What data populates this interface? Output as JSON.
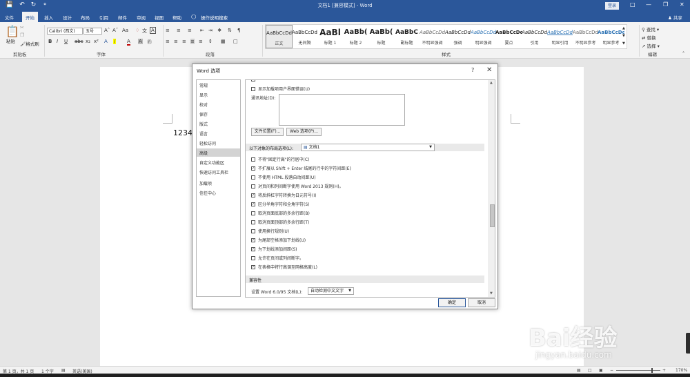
{
  "title": "文档1 [兼容模式] - Word",
  "login_label": "登录",
  "share_label": "共享",
  "qat_icons": [
    "save-icon",
    "undo-icon",
    "redo-icon",
    "touch-mode-icon"
  ],
  "menu_tabs": [
    "文件",
    "开始",
    "插入",
    "设计",
    "布局",
    "引用",
    "邮件",
    "审阅",
    "视图",
    "帮助",
    "操作说明搜索"
  ],
  "active_tab": "开始",
  "ribbon": {
    "clipboard": {
      "paste": "粘贴",
      "format_painter": "格式刷",
      "label": "剪贴板"
    },
    "font": {
      "name": "Calibri (西文)",
      "size": "五号",
      "label": "字体"
    },
    "paragraph": {
      "label": "段落"
    },
    "styles": {
      "label": "样式",
      "items": [
        {
          "sample": "AaBbCcDd",
          "name": "正文"
        },
        {
          "sample": "AaBbCcDd",
          "name": "无间隔"
        },
        {
          "sample": "AaBl",
          "name": "标题 1"
        },
        {
          "sample": "AaBb(",
          "name": "标题 2"
        },
        {
          "sample": "AaBb(",
          "name": "标题"
        },
        {
          "sample": "AaBbC",
          "name": "副标题"
        },
        {
          "sample": "AaBbCcDd",
          "name": "不明显强调"
        },
        {
          "sample": "AaBbCcDd",
          "name": "强调"
        },
        {
          "sample": "AaBbCcDd",
          "name": "明显强调"
        },
        {
          "sample": "AaBbCcDd",
          "name": "要点"
        },
        {
          "sample": "AaBbCcDd",
          "name": "引用"
        },
        {
          "sample": "AaBbCcDd",
          "name": "明显引用"
        },
        {
          "sample": "AaBbCcDd",
          "name": "不明显参考"
        },
        {
          "sample": "AaBbCcDd",
          "name": "明显参考"
        }
      ]
    },
    "editing": {
      "find": "查找",
      "replace": "替换",
      "select": "选择",
      "label": "编辑"
    }
  },
  "document": {
    "text": "1234"
  },
  "dialog": {
    "title": "Word 选项",
    "help": "?",
    "close": "✕",
    "nav": [
      "常规",
      "显示",
      "校对",
      "保存",
      "版式",
      "语言",
      "轻松访问",
      "高级",
      "自定义功能区",
      "快速访问工具栏",
      "加载项",
      "信任中心"
    ],
    "active_nav": "高级",
    "show_addin_errors": "显示加载项用户界面错误(U)",
    "mailing_address_label": "通讯地址(D):",
    "file_locations_btn": "文件位置(F)...",
    "web_options_btn": "Web 选项(P)...",
    "layout_section_label": "以下对象的布局选项(L):",
    "layout_doc": "文档1",
    "options": [
      {
        "label": "不将\"固定行高\"的行居中(C)",
        "checked": false
      },
      {
        "label": "不扩展以 Shift + Enter 结尾的行中的字符间距(E)",
        "checked": true
      },
      {
        "label": "不使用 HTML 段落自动间距(U)",
        "checked": false
      },
      {
        "label": "对页间和列间断字使用 Word 2013 规则(H)。",
        "checked": false
      },
      {
        "label": "将反斜杠字符转换为日元符号(I)",
        "checked": true
      },
      {
        "label": "区分半角字符和全角字符(S)",
        "checked": true
      },
      {
        "label": "取消页面底部的多余行距(B)",
        "checked": false
      },
      {
        "label": "取消页面顶部的多余行距(T)",
        "checked": false
      },
      {
        "label": "使用换行规则(U)",
        "checked": false
      },
      {
        "label": "为尾部空格添加下划线(U)",
        "checked": true
      },
      {
        "label": "为下划线添加间距(S)",
        "checked": true
      },
      {
        "label": "允许在页间或列间断字。",
        "checked": false
      },
      {
        "label": "在表格中将行高调至网格高度(L)",
        "checked": true
      }
    ],
    "compat_section": "兼容性",
    "compat_label": "设置 Word 6.0/95 文档(L):",
    "compat_value": "自动检测中文文字",
    "ok": "确定",
    "cancel": "取消"
  },
  "status": {
    "page": "第 1 页，共 1 页",
    "words": "1 个字",
    "language": "英语(美国)",
    "zoom": "170%"
  },
  "watermark": {
    "main": "Bai经验",
    "sub": "jingyan.baidu.com"
  }
}
